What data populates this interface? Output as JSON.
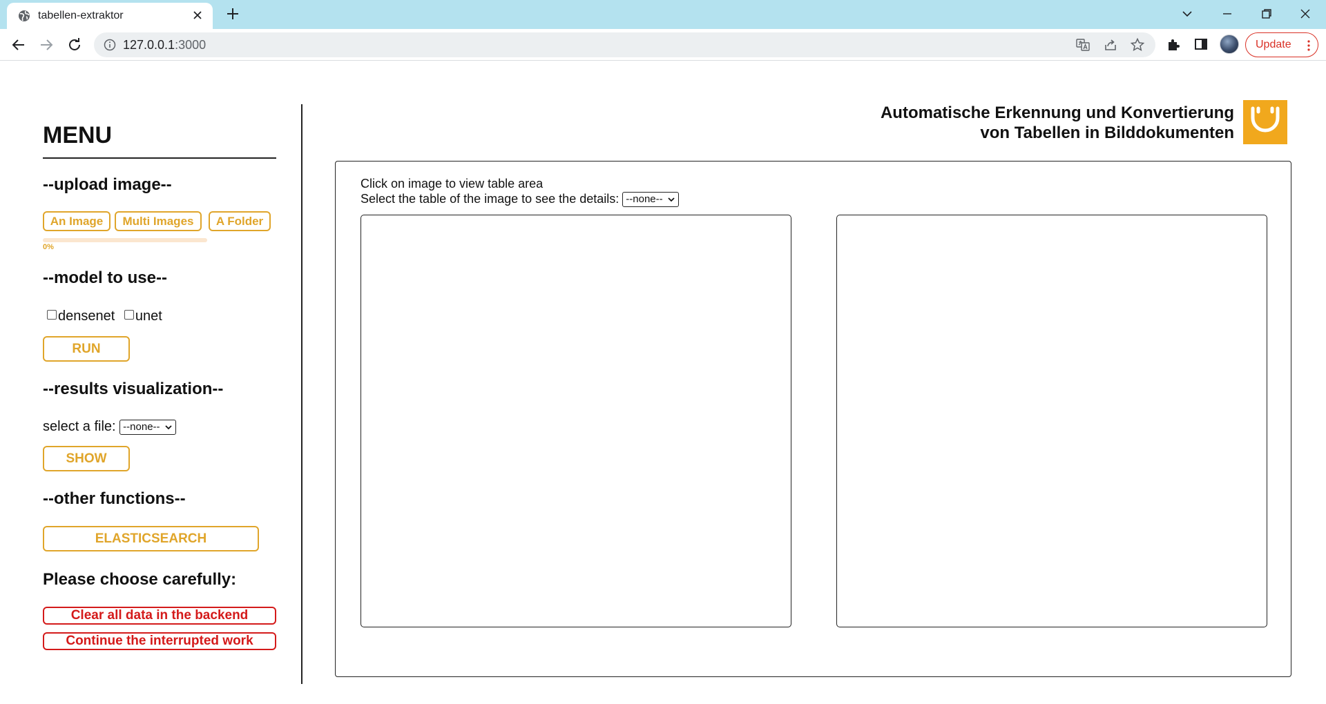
{
  "browser": {
    "tab_title": "tabellen-extraktor",
    "url_host": "127.0.0.1",
    "url_port": ":3000",
    "update_label": "Update"
  },
  "sidebar": {
    "menu_title": "MENU",
    "upload": {
      "heading": "--upload image--",
      "buttons": [
        "An Image",
        "Multi Images",
        "A Folder"
      ],
      "progress_label": "0%",
      "progress_value": 0
    },
    "model": {
      "heading": "--model to use--",
      "options": [
        {
          "label": "densenet",
          "checked": false
        },
        {
          "label": "unet",
          "checked": false
        }
      ],
      "run_label": "RUN"
    },
    "results": {
      "heading": "--results visualization--",
      "file_label": "select a file:",
      "file_selected": "--none--",
      "show_label": "SHOW"
    },
    "other": {
      "heading": "--other functions--",
      "elastic_label": "ELASTICSEARCH"
    },
    "careful": {
      "heading": "Please choose carefully:",
      "clear_label": "Clear all data in the backend",
      "continue_label": "Continue the interrupted work"
    }
  },
  "header": {
    "title_line1": "Automatische Erkennung und Konvertierung",
    "title_line2": "von Tabellen in Bilddokumenten"
  },
  "main": {
    "instruction_1": "Click on image to view table area",
    "instruction_2": "Select the table of the image to see the details:",
    "table_selected": "--none--"
  },
  "colors": {
    "accent_yellow": "#e0a52a",
    "danger_red": "#d41a1a",
    "logo_orange": "#f1a81d",
    "tabbar": "#b4e2ef"
  }
}
